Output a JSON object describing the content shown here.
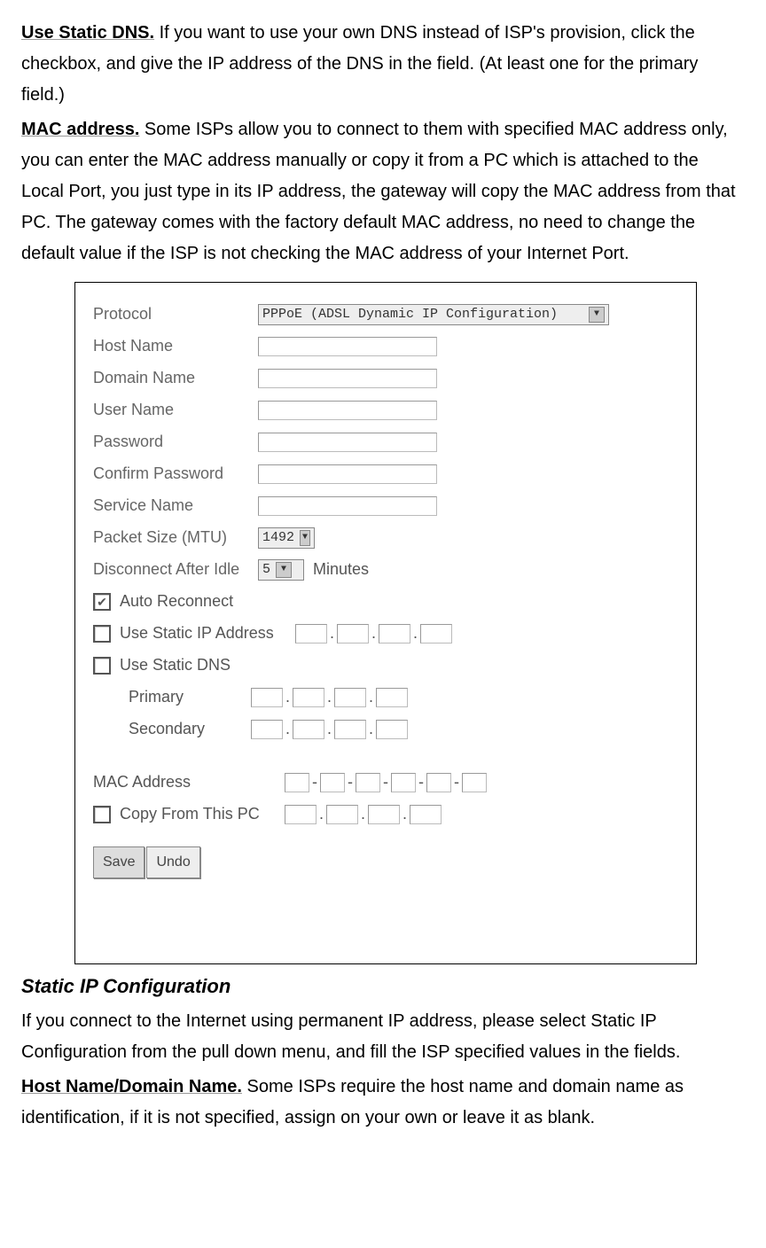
{
  "paragraphs": {
    "p1_bold": "Use Static DNS.",
    "p1_text": " If you want to use your own DNS instead of ISP's provision, click the checkbox, and give the IP address of the DNS in the field. (At least one for the primary field.)",
    "p2_bold": "MAC address.",
    "p2_text": " Some ISPs allow you to connect to them with specified MAC address only, you can enter the MAC address manually or copy it from a PC which is attached to the Local Port, you just type in its IP address, the gateway will copy the MAC address from that PC. The gateway comes with the factory default MAC address, no need to change the default value if the ISP is not checking the MAC address of your Internet Port.",
    "heading": "Static IP Configuration",
    "p3_text": "If you connect to the Internet using permanent IP address, please select Static IP Configuration from the pull down menu, and fill the ISP specified values in the fields.",
    "p4_bold": "Host Name/Domain Name.",
    "p4_text": " Some ISPs require the host name and domain name as identification, if it is not specified, assign on your own or leave it as blank."
  },
  "form": {
    "protocol_label": "Protocol",
    "protocol_value": "PPPoE (ADSL Dynamic IP Configuration)",
    "hostname": "Host Name",
    "domainname": "Domain Name",
    "username": "User Name",
    "password": "Password",
    "confirm": "Confirm Password",
    "service": "Service Name",
    "mtu_label": "Packet Size (MTU)",
    "mtu_value": "1492",
    "idle_label": "Disconnect After Idle",
    "idle_value": "5",
    "idle_unit": "Minutes",
    "auto_reconnect": "Auto Reconnect",
    "use_static_ip": "Use Static IP Address",
    "use_static_dns": "Use Static DNS",
    "primary": "Primary",
    "secondary": "Secondary",
    "mac_address": "MAC Address",
    "copy_pc": "Copy From This PC",
    "save": "Save",
    "undo": "Undo"
  }
}
